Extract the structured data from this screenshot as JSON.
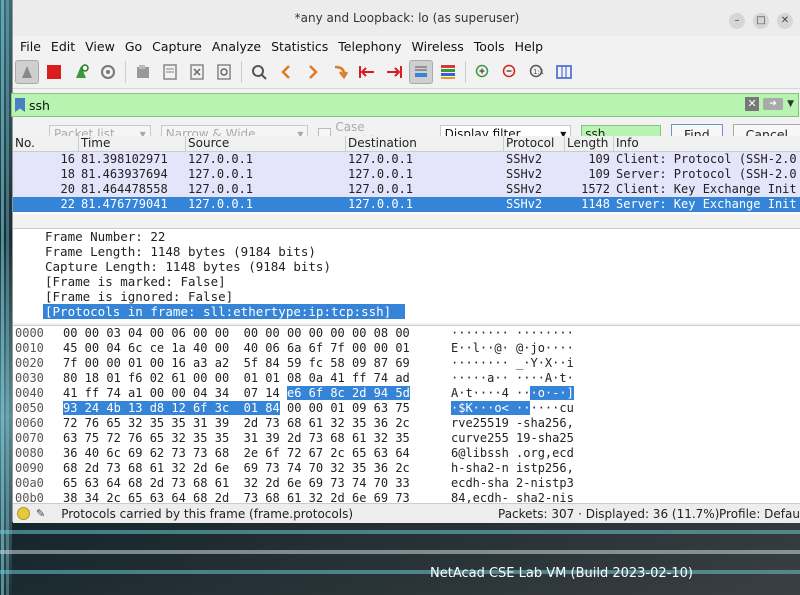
{
  "window": {
    "title": "*any and Loopback: lo (as superuser)"
  },
  "menu": [
    "File",
    "Edit",
    "View",
    "Go",
    "Capture",
    "Analyze",
    "Statistics",
    "Telephony",
    "Wireless",
    "Tools",
    "Help"
  ],
  "display_filter": {
    "value": "ssh"
  },
  "find_bar": {
    "search_in": "Packet list",
    "char_width": "Narrow & Wide",
    "case_sensitive": "Case sensitive",
    "search_type": "Display filter",
    "search_value": "ssh",
    "find_label": "Find",
    "cancel_label": "Cancel"
  },
  "packet_list": {
    "columns": [
      "No.",
      "Time",
      "Source",
      "Destination",
      "Protocol",
      "Length",
      "Info"
    ],
    "rows": [
      {
        "no": "16",
        "time": "81.398102971",
        "src": "127.0.0.1",
        "dst": "127.0.0.1",
        "proto": "SSHv2",
        "len": "109",
        "info": "Client: Protocol (SSH-2.0"
      },
      {
        "no": "18",
        "time": "81.463937694",
        "src": "127.0.0.1",
        "dst": "127.0.0.1",
        "proto": "SSHv2",
        "len": "109",
        "info": "Server: Protocol (SSH-2.0"
      },
      {
        "no": "20",
        "time": "81.464478558",
        "src": "127.0.0.1",
        "dst": "127.0.0.1",
        "proto": "SSHv2",
        "len": "1572",
        "info": "Client: Key Exchange Init"
      },
      {
        "no": "22",
        "time": "81.476779041",
        "src": "127.0.0.1",
        "dst": "127.0.0.1",
        "proto": "SSHv2",
        "len": "1148",
        "info": "Server: Key Exchange Init"
      }
    ]
  },
  "details": [
    "Frame Number: 22",
    "Frame Length: 1148 bytes (9184 bits)",
    "Capture Length: 1148 bytes (9184 bits)",
    "[Frame is marked: False]",
    "[Frame is ignored: False]",
    "[Protocols in frame: sll:ethertype:ip:tcp:ssh]"
  ],
  "hex_rows": [
    {
      "off": "0000",
      "pre": "00 00 03 04 00 06 00 00  00 00 00 00 00 00 08 00",
      "hl": "",
      "post": "",
      "apre": "········ ········",
      "ahl": "",
      "apost": ""
    },
    {
      "off": "0010",
      "pre": "45 00 04 6c ce 1a 40 00  40 06 6a 6f 7f 00 00 01",
      "hl": "",
      "post": "",
      "apre": "E··l··@· @·jo····",
      "ahl": "",
      "apost": ""
    },
    {
      "off": "0020",
      "pre": "7f 00 00 01 00 16 a3 a2  5f 84 59 fc 58 09 87 69",
      "hl": "",
      "post": "",
      "apre": "········ _·Y·X··i",
      "ahl": "",
      "apost": ""
    },
    {
      "off": "0030",
      "pre": "80 18 01 f6 02 61 00 00  01 01 08 0a 41 ff 74 ad",
      "hl": "",
      "post": "",
      "apre": "·····a·· ····A·t·",
      "ahl": "",
      "apost": ""
    },
    {
      "off": "0040",
      "pre": "41 ff 74 a1 00 00 04 34  07 14 ",
      "hl": "e6 6f 8c 2d 94 5d",
      "post": "",
      "apre": "A·t····4 ··",
      "ahl": "·o·-·]",
      "apost": ""
    },
    {
      "off": "0050",
      "pre": "",
      "hl": "93 24 4b 13 d8 12 6f 3c  01 84",
      "post": " 00 00 01 09 63 75",
      "apre": "",
      "ahl": "·$K···o< ··",
      "apost": "····cu"
    },
    {
      "off": "0060",
      "pre": "72 76 65 32 35 35 31 39  2d 73 68 61 32 35 36 2c",
      "hl": "",
      "post": "",
      "apre": "rve25519 -sha256,",
      "ahl": "",
      "apost": ""
    },
    {
      "off": "0070",
      "pre": "63 75 72 76 65 32 35 35  31 39 2d 73 68 61 32 35",
      "hl": "",
      "post": "",
      "apre": "curve255 19-sha25",
      "ahl": "",
      "apost": ""
    },
    {
      "off": "0080",
      "pre": "36 40 6c 69 62 73 73 68  2e 6f 72 67 2c 65 63 64",
      "hl": "",
      "post": "",
      "apre": "6@libssh .org,ecd",
      "ahl": "",
      "apost": ""
    },
    {
      "off": "0090",
      "pre": "68 2d 73 68 61 32 2d 6e  69 73 74 70 32 35 36 2c",
      "hl": "",
      "post": "",
      "apre": "h-sha2-n istp256,",
      "ahl": "",
      "apost": ""
    },
    {
      "off": "00a0",
      "pre": "65 63 64 68 2d 73 68 61  32 2d 6e 69 73 74 70 33",
      "hl": "",
      "post": "",
      "apre": "ecdh-sha 2-nistp3",
      "ahl": "",
      "apost": ""
    },
    {
      "off": "00b0",
      "pre": "38 34 2c 65 63 64 68 2d  73 68 61 32 2d 6e 69 73",
      "hl": "",
      "post": "",
      "apre": "84,ecdh- sha2-nis",
      "ahl": "",
      "apost": ""
    }
  ],
  "status": {
    "text": "Protocols carried by this frame (frame.protocols)",
    "packets": "Packets: 307 · Displayed: 36 (11.7%)",
    "profile": "Profile: Default"
  },
  "desktop": {
    "vm_label": "NetAcad CSE Lab VM (Build 2023-02-10)"
  },
  "colors": {
    "selection": "#3584d8",
    "row_bg": "#e4e4fb",
    "filter_ok": "#b7f4b0"
  }
}
